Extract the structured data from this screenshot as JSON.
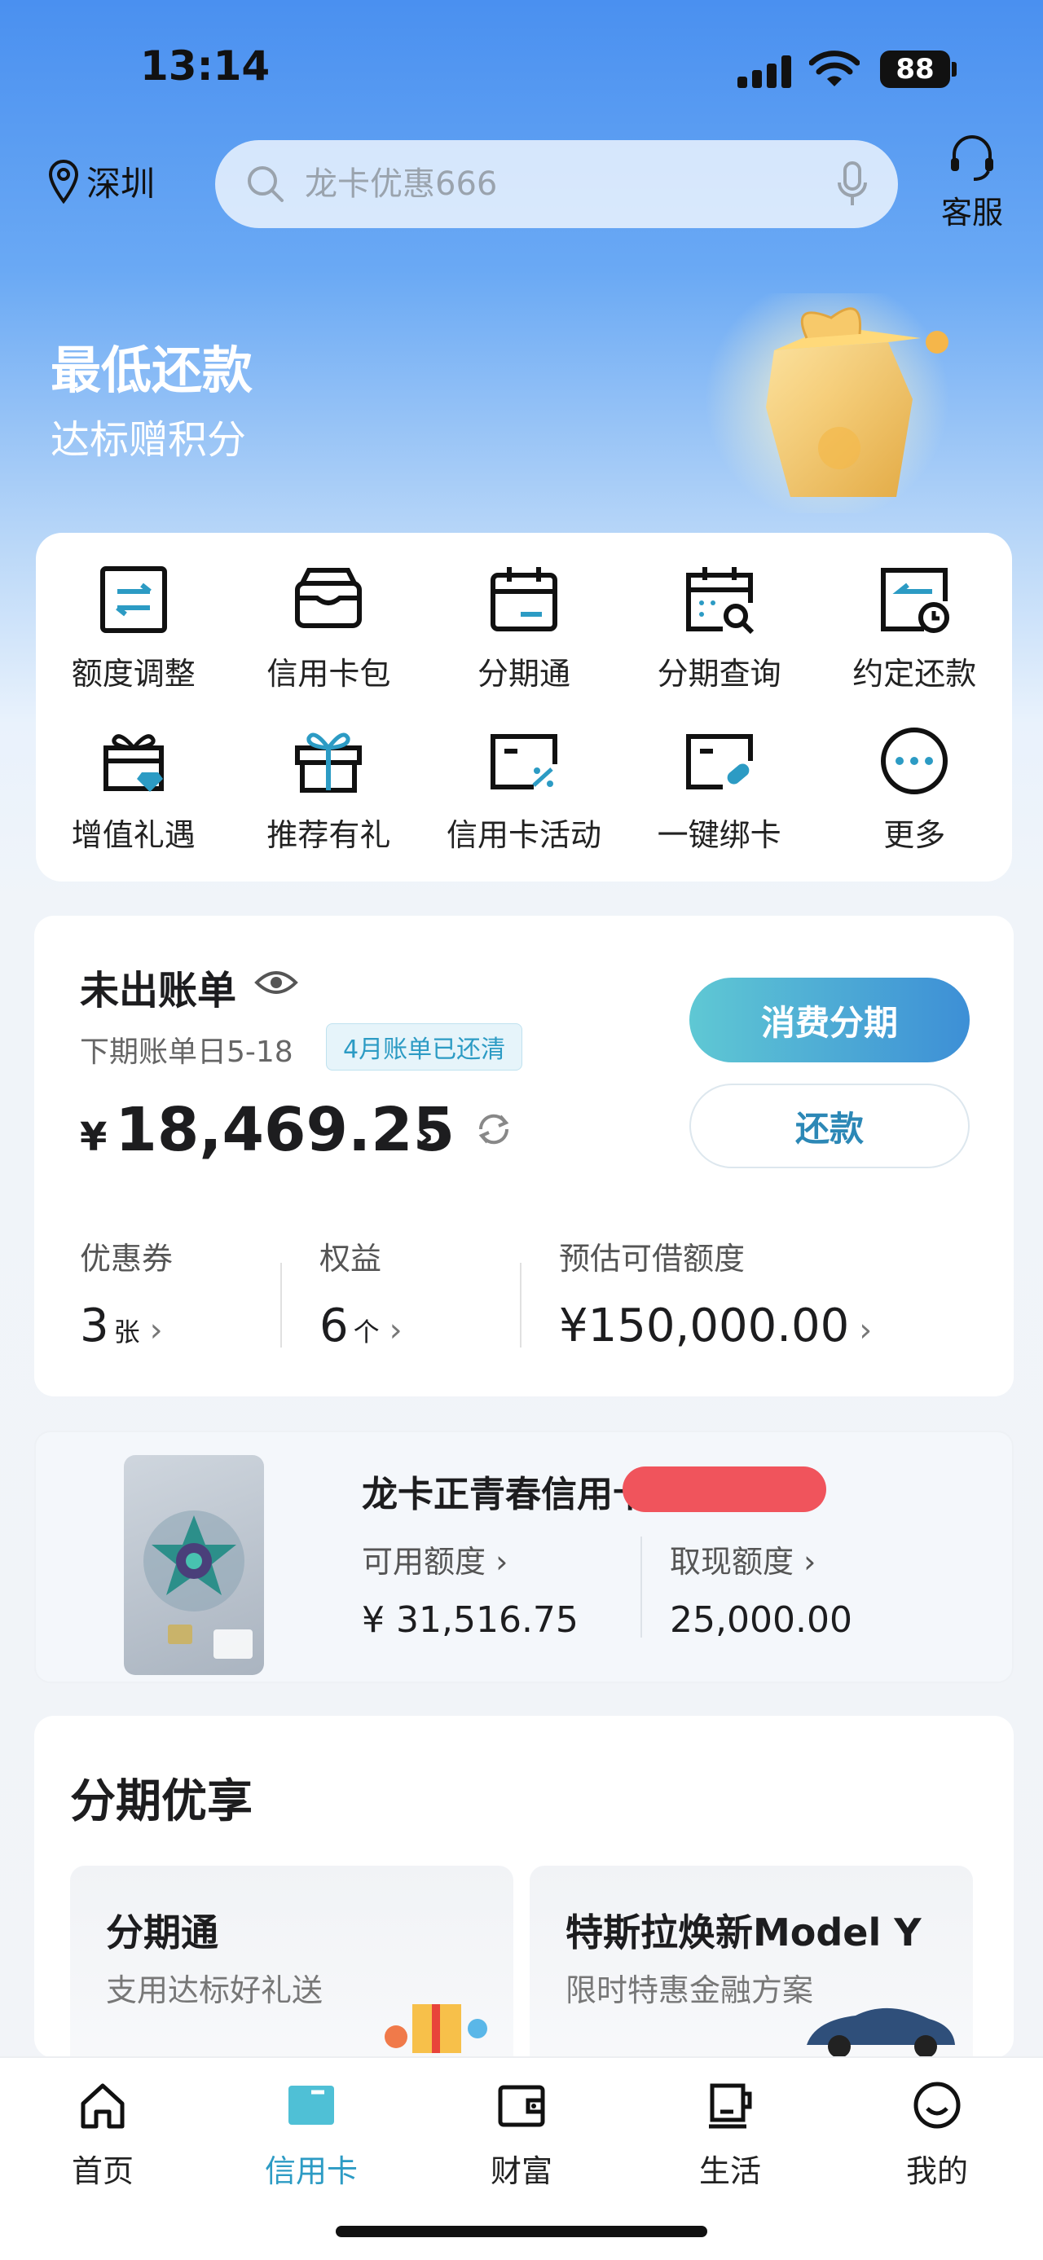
{
  "status": {
    "time": "13:14",
    "battery": "88"
  },
  "header": {
    "location": "深圳",
    "search_placeholder": "龙卡优惠666",
    "service_label": "客服"
  },
  "banner": {
    "title": "最低还款",
    "subtitle": "达标赠积分"
  },
  "menu": [
    {
      "label": "额度调整",
      "icon": "limit-adjust-icon"
    },
    {
      "label": "信用卡包",
      "icon": "card-wallet-icon"
    },
    {
      "label": "分期通",
      "icon": "calendar-icon"
    },
    {
      "label": "分期查询",
      "icon": "calendar-search-icon"
    },
    {
      "label": "约定还款",
      "icon": "scheduled-repay-icon"
    },
    {
      "label": "增值礼遇",
      "icon": "gift-diamond-icon"
    },
    {
      "label": "推荐有礼",
      "icon": "gift-icon"
    },
    {
      "label": "信用卡活动",
      "icon": "card-discount-icon"
    },
    {
      "label": "一键绑卡",
      "icon": "card-link-icon"
    },
    {
      "label": "更多",
      "icon": "more-icon"
    }
  ],
  "bill": {
    "title": "未出账单",
    "due": "下期账单日5-18",
    "paid_tag": "4月账单已还清",
    "currency": "¥",
    "amount": "18,469.25",
    "btn_installment": "消费分期",
    "btn_repay": "还款",
    "stats": [
      {
        "label": "优惠券",
        "value": "3",
        "unit": "张"
      },
      {
        "label": "权益",
        "value": "6",
        "unit": "个"
      },
      {
        "label": "预估可借额度",
        "value": "¥150,000.00",
        "unit": ""
      }
    ]
  },
  "card": {
    "name": "龙卡正青春信用卡",
    "available_label": "可用额度",
    "available_value": "¥  31,516.75",
    "cash_label": "取现额度",
    "cash_value": "25,000.00"
  },
  "promo": {
    "title": "分期优享",
    "cards": [
      {
        "title": "分期通",
        "subtitle": "支用达标好礼送"
      },
      {
        "title": "特斯拉焕新Model Y",
        "subtitle": "限时特惠金融方案"
      }
    ]
  },
  "tabs": [
    {
      "label": "首页",
      "active": false
    },
    {
      "label": "信用卡",
      "active": true
    },
    {
      "label": "财富",
      "active": false
    },
    {
      "label": "生活",
      "active": false
    },
    {
      "label": "我的",
      "active": false
    }
  ],
  "colors": {
    "accent": "#2c9bc4",
    "brand_blue": "#4a90f0"
  }
}
